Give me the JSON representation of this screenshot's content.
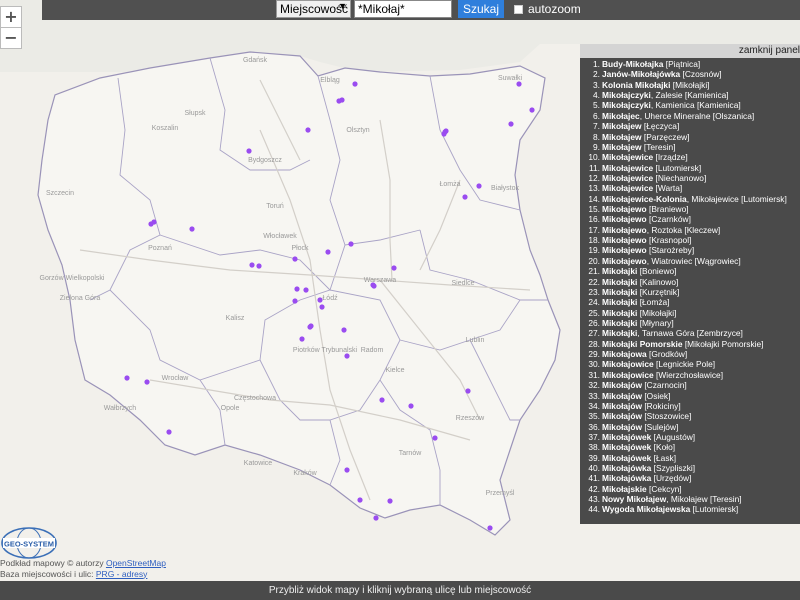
{
  "search": {
    "select_value": "Miejscowość",
    "input_value": "*Mikołaj*",
    "button_label": "Szukaj",
    "autozoom_label": "autozoom"
  },
  "zoom": {
    "in_label": "+",
    "out_label": "−"
  },
  "panel": {
    "close_label": "zamknij panel",
    "items": [
      {
        "num": "1.",
        "name": "Budy-Mikołajka",
        "detail": " [Piątnica]"
      },
      {
        "num": "2.",
        "name": "Janów-Mikołajówka",
        "detail": " [Czosnów]"
      },
      {
        "num": "3.",
        "name": "Kolonia Mikołajki",
        "detail": " [Mikołajki]"
      },
      {
        "num": "4.",
        "name": "Mikołajczyki",
        "detail": ", Zalesie [Kamienica]"
      },
      {
        "num": "5.",
        "name": "Mikołajczyki",
        "detail": ", Kamienica [Kamienica]"
      },
      {
        "num": "6.",
        "name": "Mikołajec",
        "detail": ", Uherce Mineralne [Olszanica]"
      },
      {
        "num": "7.",
        "name": "Mikołajew",
        "detail": " [Łęczyca]"
      },
      {
        "num": "8.",
        "name": "Mikołajew",
        "detail": " [Parzęczew]"
      },
      {
        "num": "9.",
        "name": "Mikołajew",
        "detail": " [Teresin]"
      },
      {
        "num": "10.",
        "name": "Mikołajewice",
        "detail": " [Irządze]"
      },
      {
        "num": "11.",
        "name": "Mikołajewice",
        "detail": " [Lutomiersk]"
      },
      {
        "num": "12.",
        "name": "Mikołajewice",
        "detail": " [Niechanowo]"
      },
      {
        "num": "13.",
        "name": "Mikołajewice",
        "detail": " [Warta]"
      },
      {
        "num": "14.",
        "name": "Mikołajewice-Kolonia",
        "detail": ", Mikołajewice [Lutomiersk]"
      },
      {
        "num": "15.",
        "name": "Mikołajewo",
        "detail": " [Braniewo]"
      },
      {
        "num": "16.",
        "name": "Mikołajewo",
        "detail": " [Czarnków]"
      },
      {
        "num": "17.",
        "name": "Mikołajewo",
        "detail": ", Roztoka [Kleczew]"
      },
      {
        "num": "18.",
        "name": "Mikołajewo",
        "detail": " [Krasnopol]"
      },
      {
        "num": "19.",
        "name": "Mikołajewo",
        "detail": " [Starożreby]"
      },
      {
        "num": "20.",
        "name": "Mikołajewo",
        "detail": ", Wiatrowiec [Wągrowiec]"
      },
      {
        "num": "21.",
        "name": "Mikołajki",
        "detail": " [Boniewo]"
      },
      {
        "num": "22.",
        "name": "Mikołajki",
        "detail": " [Kalinowo]"
      },
      {
        "num": "23.",
        "name": "Mikołajki",
        "detail": " [Kurzętnik]"
      },
      {
        "num": "24.",
        "name": "Mikołajki",
        "detail": " [Łomża]"
      },
      {
        "num": "25.",
        "name": "Mikołajki",
        "detail": " [Mikołajki]"
      },
      {
        "num": "26.",
        "name": "Mikołajki",
        "detail": " [Młynary]"
      },
      {
        "num": "27.",
        "name": "Mikołajki",
        "detail": ", Tarnawa Góra [Zembrzyce]"
      },
      {
        "num": "28.",
        "name": "Mikołajki Pomorskie",
        "detail": " [Mikołajki Pomorskie]"
      },
      {
        "num": "29.",
        "name": "Mikołajowa",
        "detail": " [Grodków]"
      },
      {
        "num": "30.",
        "name": "Mikołajowice",
        "detail": " [Legnickie Pole]"
      },
      {
        "num": "31.",
        "name": "Mikołajowice",
        "detail": " [Wierzchosławice]"
      },
      {
        "num": "32.",
        "name": "Mikołajów",
        "detail": " [Czarnocin]"
      },
      {
        "num": "33.",
        "name": "Mikołajów",
        "detail": " [Osiek]"
      },
      {
        "num": "34.",
        "name": "Mikołajów",
        "detail": " [Rokiciny]"
      },
      {
        "num": "35.",
        "name": "Mikołajów",
        "detail": " [Stoszowice]"
      },
      {
        "num": "36.",
        "name": "Mikołajów",
        "detail": " [Sulejów]"
      },
      {
        "num": "37.",
        "name": "Mikołajówek",
        "detail": " [Augustów]"
      },
      {
        "num": "38.",
        "name": "Mikołajówek",
        "detail": " [Koło]"
      },
      {
        "num": "39.",
        "name": "Mikołajówek",
        "detail": " [Łask]"
      },
      {
        "num": "40.",
        "name": "Mikołajówka",
        "detail": " [Szypliszki]"
      },
      {
        "num": "41.",
        "name": "Mikołajówka",
        "detail": " [Urzędów]"
      },
      {
        "num": "42.",
        "name": "Mikołajskie",
        "detail": " [Cekcyn]"
      },
      {
        "num": "43.",
        "name": "Nowy Mikołajew",
        "detail": ", Mikołajew [Teresin]"
      },
      {
        "num": "44.",
        "name": "Wygoda Mikołajewska",
        "detail": " [Lutomiersk]"
      }
    ]
  },
  "map": {
    "marker_color": "#9a4cf0",
    "marker_count": 46,
    "city_labels": [
      "Gdańsk",
      "Elbląg",
      "Olsztyn",
      "Białystok",
      "Łomża",
      "Bydgoszcz",
      "Toruń",
      "Włocławek",
      "Poznań",
      "Gorzów Wielkopolski",
      "Zielona Góra",
      "Warszawa",
      "Płock",
      "Łódź",
      "Kalisz",
      "Piotrków Trybunalski",
      "Siedlce",
      "Lublin",
      "Wrocław",
      "Wałbrzych",
      "Opole",
      "Częstochowa",
      "Kielce",
      "Radom",
      "Katowice",
      "Kraków",
      "Tarnów",
      "Rzeszów",
      "Przemyśl",
      "Koszalin",
      "Słupsk",
      "Szczecin",
      "Suwałki"
    ]
  },
  "logo_text": "GEO-SYSTEM",
  "attribution": {
    "line1_prefix": "Podkład mapowy © autorzy ",
    "line1_link": "OpenStreetMap",
    "line2_prefix": "Baza miejscowości i ulic: ",
    "line2_link": "PRG - adresy"
  },
  "status_text": "Przybliż widok mapy i kliknij wybraną ulicę lub miejscowość"
}
